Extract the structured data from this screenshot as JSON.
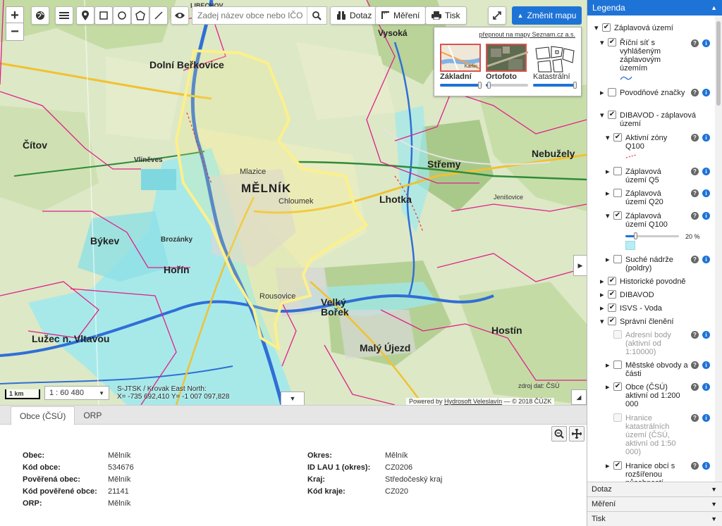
{
  "toolbar": {
    "zoom_in": "+",
    "zoom_out": "−",
    "search_placeholder": "Zadej název obce nebo IČO",
    "dotaz": "Dotaz",
    "mereni": "Měření",
    "tisk": "Tisk",
    "zmenit_mapu": "Změnit mapu"
  },
  "switcher": {
    "seznam_link": "přepnout na mapy Seznam.cz a.s.",
    "maps": [
      {
        "label": "Základní",
        "opacity": 0.95
      },
      {
        "label": "Ortofoto",
        "opacity": 0.08
      },
      {
        "label": "Katastrální",
        "opacity": 1.0
      }
    ],
    "thumb_text": "Karlín"
  },
  "map": {
    "labels": {
      "melnik": "MĚLNÍK",
      "dolni_berkovice": "Dolní Beřkovice",
      "citov": "Čítov",
      "bykev": "Býkev",
      "horin": "Hořín",
      "luzec": "Lužec n. Vltavou",
      "lhotka": "Lhotka",
      "stremy": "Střemy",
      "nebuzely": "Nebužely",
      "velky_borek": "Velký Bořek",
      "maly_ujezd": "Malý Újezd",
      "hostin": "Hostín",
      "vysoka": "Vysoká",
      "mlazice": "Mlazice",
      "chloumek": "Chloumek",
      "rousovice": "Rousovice",
      "vliněves": "Vliněves",
      "brozanky": "Brozánky",
      "jenisovice": "Jenišovice",
      "libechov": "LIBECHOV"
    },
    "scale_bar": "1 km",
    "scale_value": "1 : 60 480",
    "crs_line": "S-JTSK / Krovak East North:",
    "coord_line": "X= -735 692,410 Y= -1 007 097,828",
    "data_source": "zdroj dat: ČSÚ",
    "copyright_prefix": "Powered by",
    "copyright_link": "Hydrosoft Veleslavín",
    "copyright_suffix": "— © 2018 ČÚZK"
  },
  "bottom": {
    "tabs": [
      "Obce (ČSÚ)",
      "ORP"
    ],
    "active_tab": 0,
    "left": [
      {
        "k": "Obec:",
        "v": "Mělník"
      },
      {
        "k": "Kód obce:",
        "v": "534676"
      },
      {
        "k": "Pověřená obec:",
        "v": "Mělník"
      },
      {
        "k": "Kód pověřené obce:",
        "v": "21141"
      },
      {
        "k": "ORP:",
        "v": "Mělník"
      }
    ],
    "right": [
      {
        "k": "Okres:",
        "v": "Mělník"
      },
      {
        "k": "ID LAU 1 (okres):",
        "v": "CZ0206"
      },
      {
        "k": "Kraj:",
        "v": "Středočeský kraj"
      },
      {
        "k": "Kód kraje:",
        "v": "CZ020"
      }
    ]
  },
  "legend": {
    "title": "Legenda",
    "items": {
      "zaplavova_uzemi": "Záplavová území",
      "ricni_sit": "Říční síť s vyhlášeným záplavovým územím",
      "povodnove_znacky": "Povodňové značky",
      "dibavod_zu": "DIBAVOD - záplavová území",
      "aktivni_zony": "Aktivní zóny Q100",
      "zu_q5": "Záplavová území Q5",
      "zu_q20": "Záplavová území Q20",
      "zu_q100": "Záplavová území Q100",
      "opacity_value": "20 %",
      "opacity_level": 0.2,
      "suche_nadrze": "Suché nádrže (poldry)",
      "historicke": "Historické povodně",
      "dibavod": "DIBAVOD",
      "isvs": "ISVS - Voda",
      "spravni": "Správní členění",
      "adresni": "Adresní body (aktivní od 1:10000)",
      "mestske": "Městské obvody a části",
      "obce": "Obce (ČSÚ) aktivní od 1:200 000",
      "hranice_kat": "Hranice katastrálních území (ČSÚ, aktivní od 1:50 000)",
      "hranice_obci": "Hranice obcí s rozšířenou působností"
    },
    "accordion": [
      "Dotaz",
      "Měření",
      "Tisk"
    ]
  },
  "colors": {
    "accent": "#1e73d6",
    "flood_zone": "#9ee9ee",
    "boundary": "#e0208a",
    "municipality": "#f5ee8a"
  }
}
